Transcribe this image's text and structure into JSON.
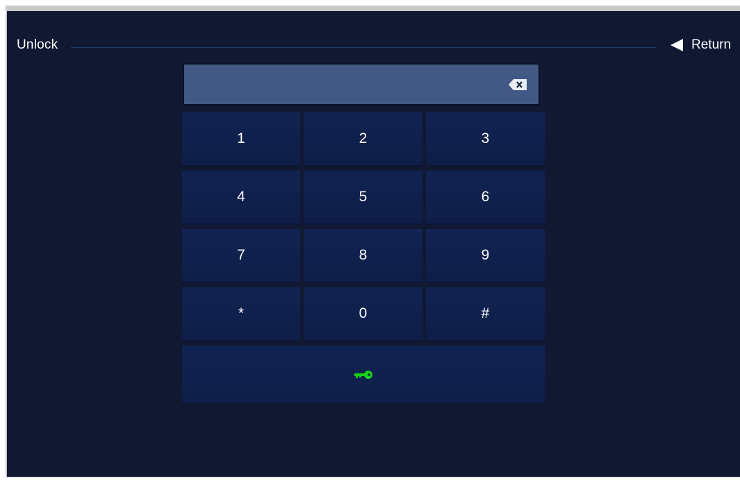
{
  "header": {
    "title": "Unlock",
    "return_label": "Return",
    "line_color": "#1f3869"
  },
  "display": {
    "value": "",
    "backspace_icon": "backspace-icon"
  },
  "keypad": {
    "keys": [
      "1",
      "2",
      "3",
      "4",
      "5",
      "6",
      "7",
      "8",
      "9",
      "*",
      "0",
      "#"
    ]
  },
  "unlock": {
    "icon": "key-icon",
    "icon_color": "#16d016"
  },
  "colors": {
    "background": "#111831",
    "key_face": "#112353",
    "display_bg": "#425985"
  }
}
